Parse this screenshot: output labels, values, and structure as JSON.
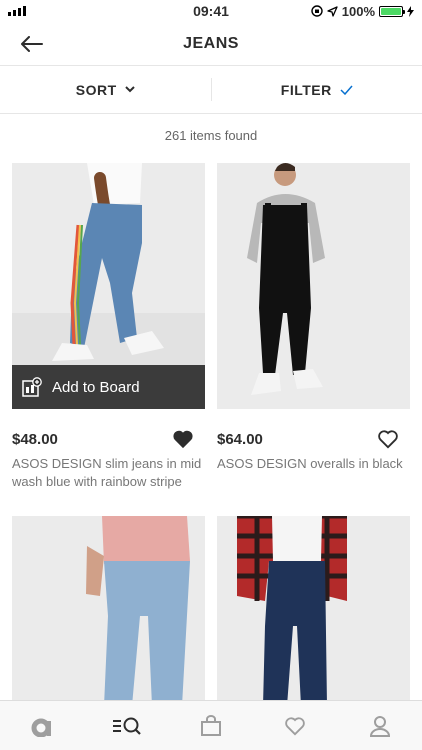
{
  "status": {
    "time": "09:41",
    "battery": "100%"
  },
  "header": {
    "title": "JEANS"
  },
  "toolbar": {
    "sort_label": "SORT",
    "filter_label": "FILTER"
  },
  "results": {
    "count_text": "261 items found"
  },
  "products": [
    {
      "price": "$48.00",
      "description": "ASOS DESIGN slim jeans in mid wash blue with rainbow stripe",
      "board_label": "Add to Board",
      "saved": true
    },
    {
      "price": "$64.00",
      "description": "ASOS DESIGN overalls in black",
      "saved": false
    }
  ],
  "tabs": [
    "home-icon",
    "search-icon",
    "bag-icon",
    "saved-icon",
    "account-icon"
  ],
  "colors": {
    "accent": "#2d2d2d",
    "filter_check": "#0770cf",
    "battery": "#4cd964"
  }
}
